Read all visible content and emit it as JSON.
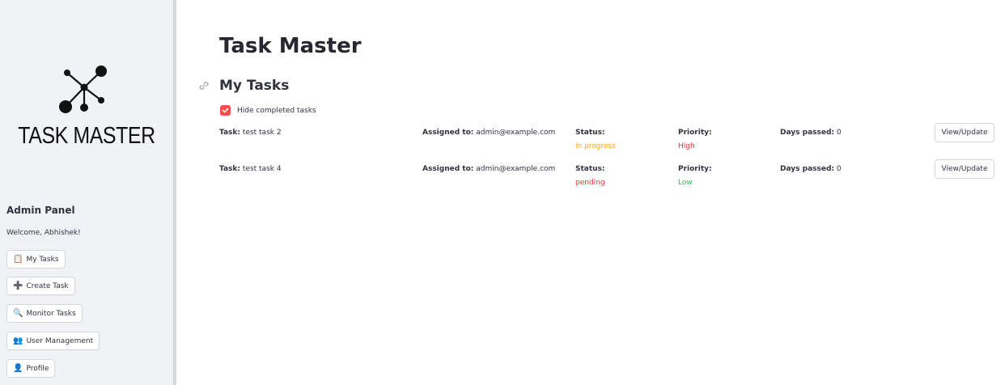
{
  "colors": {
    "accent": "#ff4b4b",
    "in_progress": "#ffa421",
    "high": "#ff2b2b",
    "pending": "#ff2b2b",
    "low": "#21c354",
    "sidebar_bg": "#f0f2f6"
  },
  "sidebar": {
    "logo_icon": "network-nodes-icon",
    "logo_text": "TASK MASTER",
    "panel_title": "Admin Panel",
    "welcome": "Welcome, Abhishek!",
    "nav": [
      {
        "icon": "clipboard-icon",
        "glyph": "📋",
        "label": "My Tasks"
      },
      {
        "icon": "plus-icon",
        "glyph": "➕",
        "label": "Create Task"
      },
      {
        "icon": "magnifier-icon",
        "glyph": "🔍",
        "label": "Monitor Tasks"
      },
      {
        "icon": "users-icon",
        "glyph": "👥",
        "label": "User Management"
      },
      {
        "icon": "user-icon",
        "glyph": "👤",
        "label": "Profile"
      }
    ]
  },
  "main": {
    "title": "Task Master",
    "section_title": "My Tasks",
    "hide_completed": {
      "label": "Hide completed tasks",
      "checked": true
    },
    "labels": {
      "task": "Task:",
      "assigned": "Assigned to:",
      "status": "Status:",
      "priority": "Priority:",
      "days": "Days passed:",
      "button": "View/Update"
    },
    "tasks": [
      {
        "name": "test task 2",
        "assigned_to": "admin@example.com",
        "status": "in progress",
        "status_color": "#ffa421",
        "priority": "High",
        "priority_color": "#ff2b2b",
        "days_passed": "0"
      },
      {
        "name": "test task 4",
        "assigned_to": "admin@example.com",
        "status": "pending",
        "status_color": "#ff2b2b",
        "priority": "Low",
        "priority_color": "#21c354",
        "days_passed": "0"
      }
    ]
  }
}
